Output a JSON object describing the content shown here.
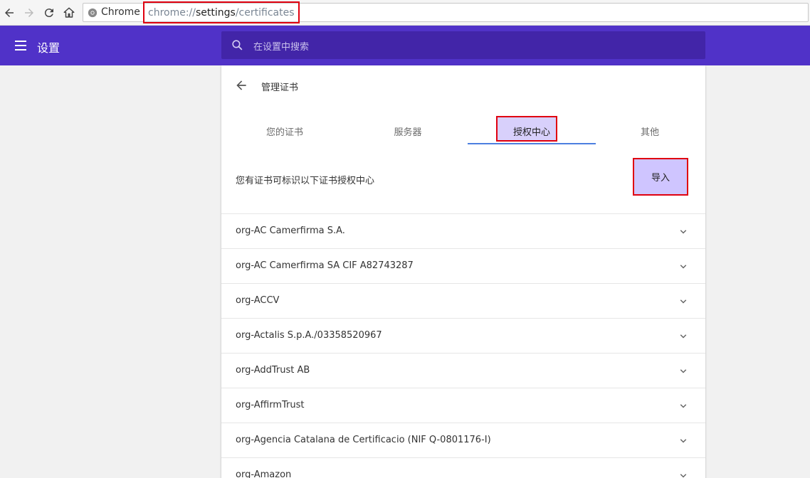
{
  "browser": {
    "chip_label": "Chrome",
    "url_scheme": "chrome://",
    "url_host": "settings",
    "url_path": "/certificates"
  },
  "header": {
    "title": "设置",
    "search_placeholder": "在设置中搜索"
  },
  "page": {
    "title": "管理证书",
    "tabs": [
      {
        "label": "您的证书",
        "active": false
      },
      {
        "label": "服务器",
        "active": false
      },
      {
        "label": "授权中心",
        "active": true
      },
      {
        "label": "其他",
        "active": false
      }
    ],
    "description": "您有证书可标识以下证书授权中心",
    "import_label": "导入",
    "authorities": [
      "org-AC Camerfirma S.A.",
      "org-AC Camerfirma SA CIF A82743287",
      "org-ACCV",
      "org-Actalis S.p.A./03358520967",
      "org-AddTrust AB",
      "org-AffirmTrust",
      "org-Agencia Catalana de Certificacio (NIF Q-0801176-I)",
      "org-Amazon"
    ]
  },
  "colors": {
    "header": "#5032c8",
    "search": "#4225a8",
    "highlight_border": "#e0000f",
    "tab_underline": "#4d7fe0"
  }
}
